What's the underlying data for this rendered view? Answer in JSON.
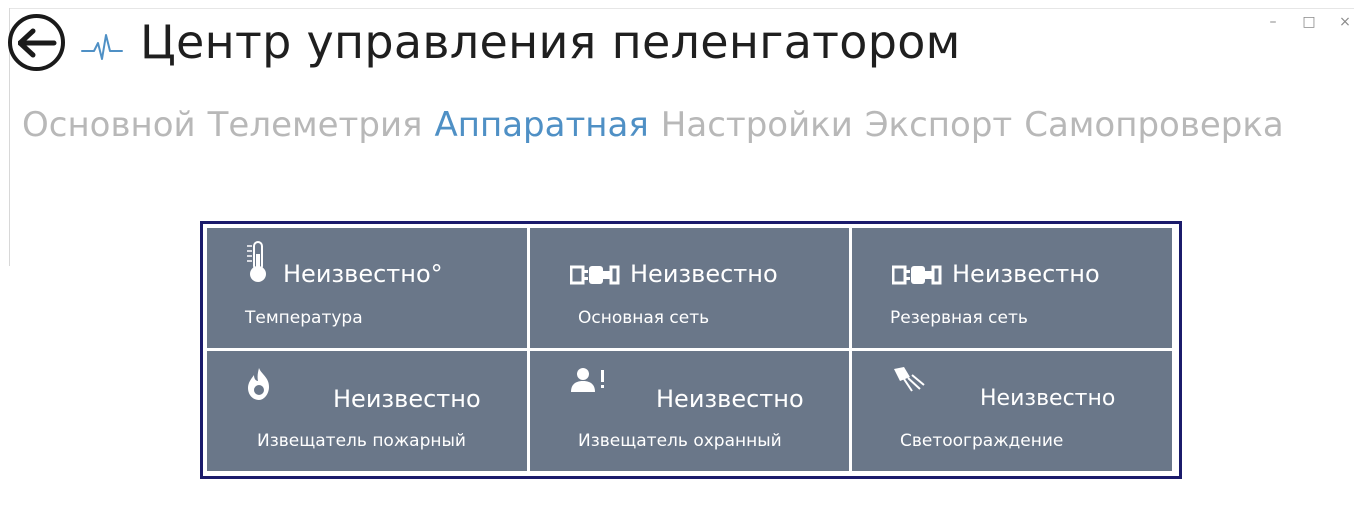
{
  "window": {
    "title": "Центр управления пеленгатором",
    "back_icon": "arrow-left-icon",
    "logo_icon": "heartbeat-icon",
    "controls": {
      "minimize": "–",
      "maximize": "□",
      "close": "×"
    }
  },
  "tabs": [
    {
      "label": "Основной",
      "active": false
    },
    {
      "label": "Телеметрия",
      "active": false
    },
    {
      "label": "Аппаратная",
      "active": true
    },
    {
      "label": "Настройки",
      "active": false
    },
    {
      "label": "Экспорт",
      "active": false
    },
    {
      "label": "Самопроверка",
      "active": false
    }
  ],
  "colors": {
    "active_tab": "#4f90c5",
    "inactive_tab": "#b8b8b8",
    "tile_background": "#6a7789",
    "panel_border": "#1b1b6b"
  },
  "tiles": [
    {
      "icon": "thermometer-icon",
      "value": "Неизвестно°",
      "label": "Температура"
    },
    {
      "icon": "power-plug-icon",
      "value": "Неизвестно",
      "label": "Основная сеть"
    },
    {
      "icon": "power-plug-icon",
      "value": "Неизвестно",
      "label": "Резервная сеть"
    },
    {
      "icon": "flame-icon",
      "value": "Неизвестно",
      "label": "Извещатель пожарный"
    },
    {
      "icon": "person-alert-icon",
      "value": "Неизвестно",
      "label": "Извещатель охранный"
    },
    {
      "icon": "light-beam-icon",
      "value": "Неизвестно",
      "label": "Светоограждение"
    }
  ]
}
